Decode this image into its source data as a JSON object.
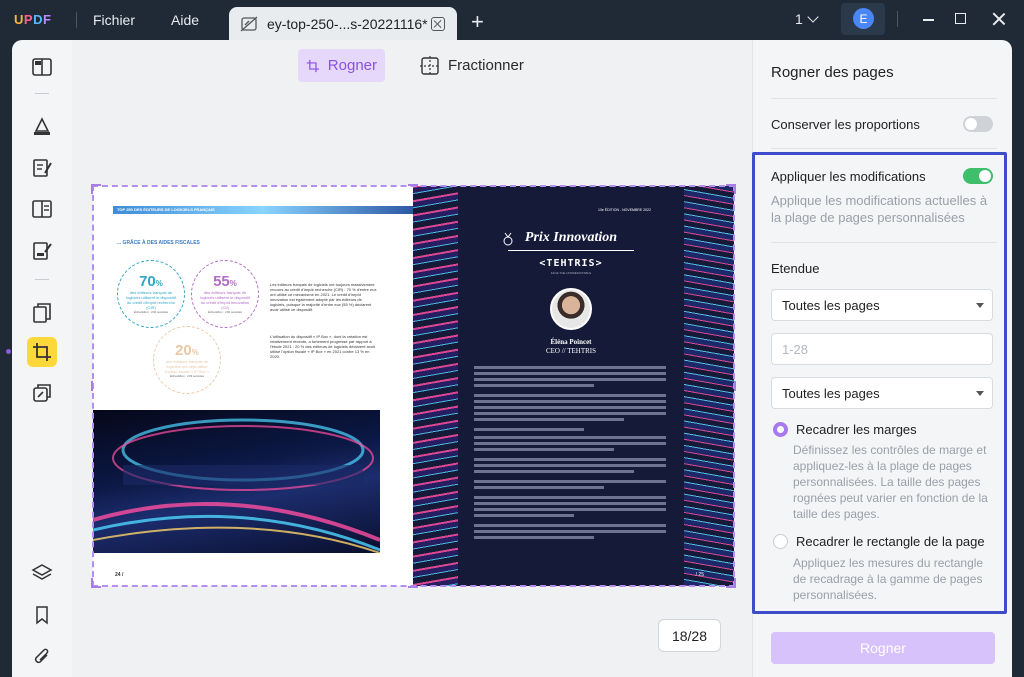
{
  "app": {
    "logo": "UPDF"
  },
  "menu": {
    "file": "Fichier",
    "help": "Aide"
  },
  "tab": {
    "title": "ey-top-250-...s-20221116*"
  },
  "titlebar": {
    "page_count": "1",
    "avatar_initial": "E"
  },
  "mode": {
    "crop": "Rogner",
    "split": "Fractionner"
  },
  "document": {
    "left_page": {
      "header": "TOP 250 DES ÉDITEURS DE LOGICIELS FRANÇAIS",
      "section": "... GRÂCE À DES AIDES FISCALES",
      "bubble1": {
        "value": "70",
        "unit": "%",
        "text": "des éditeurs français de logiciels utilisent le dispositif du crédit d'impôt recherche (CIR)",
        "sub": "Échantillon : 240 sociétés"
      },
      "bubble2": {
        "value": "55",
        "unit": "%",
        "text": "des éditeurs français de logiciels utilisent le dispositif du crédit d'impôt innovation (CII)",
        "sub": "Échantillon : 240 sociétés"
      },
      "bubble3": {
        "value": "20",
        "unit": "%",
        "text": "des éditeurs français de logiciels ont déjà utilisé l'option fiscale « IP Box »",
        "sub": "Échantillon : 233 sociétés"
      },
      "paragraph1": "Les éditeurs français de logiciels ont toujours massivement recours au crédit d'impôt recherche (CIR) : 70 % d'entre eux ont utilisé ce mécanisme en 2021. Le crédit d'impôt innovation est également adopté par les éditeurs de logiciels, puisque la majorité d'entre eux (55 %) déclarent avoir utilisé ce dispositif.",
      "paragraph2": "L'utilisation du dispositif « IP Box », dont la création est relativement récente, a fortement progressé par rapport à l'étude 2021 : 20 % des éditeurs de logiciels déclarent avoir utilisé l'option fiscale « IP Box » en 2021 contre 13 % en 2020.",
      "page_number": "24 /"
    },
    "right_page": {
      "edition": "10e ÉDITION - NOVEMBRE 2022",
      "award": "Prix Innovation",
      "company": "<TEHTRIS>",
      "tagline": "FACE THE UNPREDICTABLE",
      "person_name": "Éléna Poincet",
      "person_role": "CEO // TEHTRIS",
      "page_number": "/ 25"
    }
  },
  "page_indicator": "18/28",
  "panel": {
    "title": "Rogner des pages",
    "keep_proportions": {
      "label": "Conserver les proportions",
      "enabled": false
    },
    "apply_changes": {
      "label": "Appliquer les modifications",
      "enabled": true,
      "description": "Applique les modifications actuelles à la plage de pages personnalisées"
    },
    "range_label": "Etendue",
    "range_select": "Toutes les pages",
    "range_input_placeholder": "1-28",
    "subset_select": "Toutes les pages",
    "option_margins": {
      "label": "Recadrer les marges",
      "selected": true,
      "description": "Définissez les contrôles de marge et appliquez-les à la plage de pages personnalisées. La taille des pages rognées peut varier en fonction de la taille des pages."
    },
    "option_rect": {
      "label": "Recadrer le rectangle de la page",
      "selected": false,
      "description": "Appliquez les mesures du rectangle de recadrage à la gamme de pages personnalisées."
    },
    "apply_button": "Rogner"
  },
  "colors": {
    "accent": "#8a51e4",
    "highlight_box": "#3d4cc8",
    "toggle_on": "#3fbe6c",
    "titlebar": "#1f2a36"
  }
}
